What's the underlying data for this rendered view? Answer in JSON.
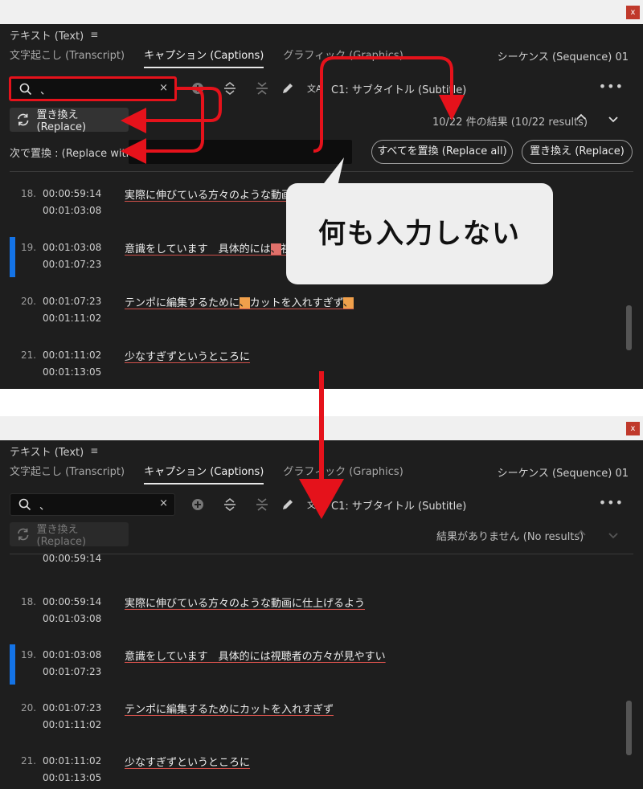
{
  "panel": {
    "title": "テキスト (Text)",
    "menu_icon": "≡",
    "tabs": [
      "文字起こし (Transcript)",
      "キャプション (Captions)",
      "グラフィック (Graphics)"
    ],
    "sequence": "シーケンス (Sequence) 01",
    "close": "x",
    "caption_track": "C1: サブタイトル (Subtitle)",
    "more": "•••",
    "icons": [
      "search-icon",
      "clear-icon",
      "add-icon",
      "split-icon",
      "merge-icon",
      "pencil-icon",
      "translate-icon",
      "refresh-icon",
      "chevron-up-icon",
      "chevron-down-icon"
    ]
  },
  "before": {
    "search_value": "、",
    "search_clear": "×",
    "replace_button": "置き換え (Replace)",
    "results": "10/22 件の結果 (10/22 results)",
    "replace_with_label": "次で置換 : (Replace with:)",
    "replace_all_button": "すべてを置換 (Replace all)",
    "replace_button_right": "置き換え (Replace)",
    "rows": [
      {
        "num": "18.",
        "tc_in": "00:00:59:14",
        "tc_out": "00:01:03:08",
        "text": "実際に伸びている方々のような動画に"
      },
      {
        "num": "19.",
        "tc_in": "00:01:03:08",
        "tc_out": "00:01:07:23",
        "text_a": "意識をしています　具体的には",
        "hit": "、",
        "text_b": "視聴"
      },
      {
        "num": "20.",
        "tc_in": "00:01:07:23",
        "tc_out": "00:01:11:02",
        "text_a": "テンポに編集するために",
        "hit1": "、",
        "text_b": "カットを入れすぎず",
        "hit2": "、"
      },
      {
        "num": "21.",
        "tc_in": "00:01:11:02",
        "tc_out": "00:01:13:05",
        "text": "少なすぎずというところに"
      }
    ],
    "callout": "何も入力しない"
  },
  "after": {
    "search_value": "、",
    "search_clear": "×",
    "replace_button": "置き換え (Replace)",
    "results": "結果がありません (No results)",
    "partial_tc": "00:00:59:14",
    "rows": [
      {
        "num": "18.",
        "tc_in": "00:00:59:14",
        "tc_out": "00:01:03:08",
        "text": "実際に伸びている方々のような動画に仕上げるよう"
      },
      {
        "num": "19.",
        "tc_in": "00:01:03:08",
        "tc_out": "00:01:07:23",
        "text": "意識をしています　具体的には視聴者の方々が見やすい"
      },
      {
        "num": "20.",
        "tc_in": "00:01:07:23",
        "tc_out": "00:01:11:02",
        "text": "テンポに編集するためにカットを入れすぎず"
      },
      {
        "num": "21.",
        "tc_in": "00:01:11:02",
        "tc_out": "00:01:13:05",
        "text": "少なすぎずというところに"
      }
    ]
  },
  "colors": {
    "annotation": "#e5121b",
    "highlight_orange": "#f0a04b",
    "highlight_red": "#e0706a",
    "active_marker": "#1473e6"
  }
}
